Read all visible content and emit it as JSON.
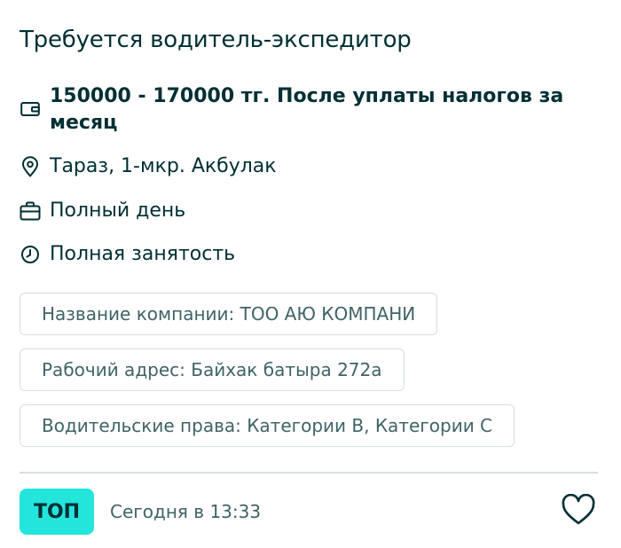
{
  "listing": {
    "title": "Требуется водитель-экспедитор",
    "salary": "150000 - 170000 тг. После уплаты налогов за месяц",
    "location": "Тараз, 1-мкр. Акбулак",
    "schedule": "Полный день",
    "employment": "Полная занятость"
  },
  "tags": [
    "Название компании: ТОО АЮ КОМПАНИ",
    "Рабочий адрес: Байхак батыра 272а",
    "Водительские права: Категории B, Категории C"
  ],
  "footer": {
    "badge": "ТОП",
    "posted": "Сегодня в 13:33"
  },
  "icons": {
    "salary": "wallet-icon",
    "location": "location-pin-icon",
    "schedule": "briefcase-icon",
    "employment": "clock-icon",
    "favorite": "heart-icon"
  },
  "colors": {
    "text": "#002f34",
    "muted": "#406367",
    "badge": "#23e5db",
    "border": "#d8dfe0"
  }
}
